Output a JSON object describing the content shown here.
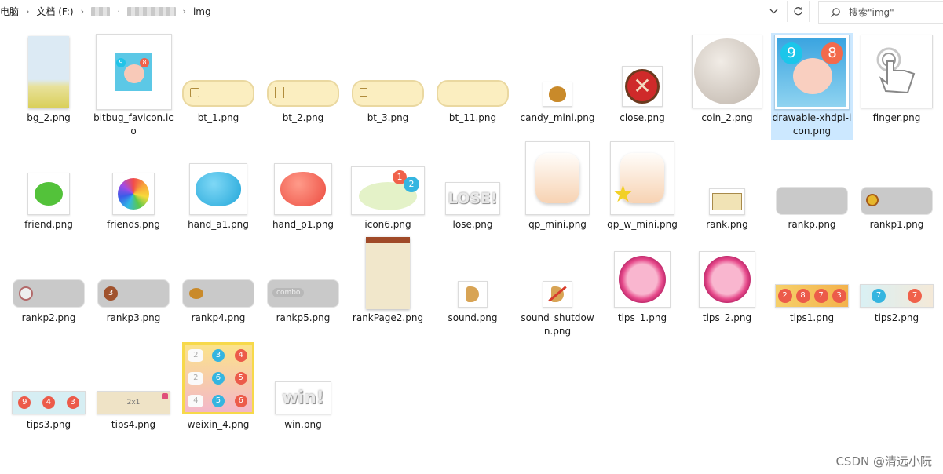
{
  "address_bar": {
    "crumbs": [
      "电脑",
      "文档 (F:)",
      "img"
    ],
    "placeholder_search": "搜索\"img\""
  },
  "files": [
    "bg_2.png",
    "bitbug_favicon.ico",
    "bt_1.png",
    "bt_2.png",
    "bt_3.png",
    "bt_11.png",
    "candy_mini.png",
    "close.png",
    "coin_2.png",
    "drawable-xhdpi-icon.png",
    "finger.png",
    "friend.png",
    "friends.png",
    "hand_a1.png",
    "hand_p1.png",
    "icon6.png",
    "lose.png",
    "qp_mini.png",
    "qp_w_mini.png",
    "rank.png",
    "rankp.png",
    "rankp1.png",
    "rankp2.png",
    "rankp3.png",
    "rankp4.png",
    "rankp5.png",
    "rankPage2.png",
    "sound.png",
    "sound_shutdown.png",
    "tips_1.png",
    "tips_2.png",
    "tips1.png",
    "tips2.png",
    "tips3.png",
    "tips4.png",
    "weixin_4.png",
    "win.png"
  ],
  "selected_file": "drawable-xhdpi-icon.png",
  "thumb_text": {
    "lose": "LOSE!",
    "win": "win!",
    "combo": "combo",
    "icon_badge_left": "9",
    "icon_badge_right": "8",
    "icon6_badge_1": "1",
    "icon6_badge_2": "2",
    "rankp3_badge": "3",
    "tips1_digits": [
      "2",
      "8",
      "7",
      "3"
    ],
    "tips2_digits": [
      "7",
      "7"
    ],
    "tips3_digits": [
      "9",
      "4",
      "3"
    ],
    "tips4_text": "2x1",
    "weixin_digits": [
      "2",
      "3",
      "4",
      "2",
      "6",
      "5",
      "4",
      "5",
      "6"
    ]
  },
  "colors": {
    "selection": "#cce8ff",
    "pill": "#fbeec0",
    "grey": "#c9c9c9",
    "badge_blue": "#35c3e8",
    "badge_red": "#f0614a"
  },
  "watermark": "CSDN @清远小阮"
}
